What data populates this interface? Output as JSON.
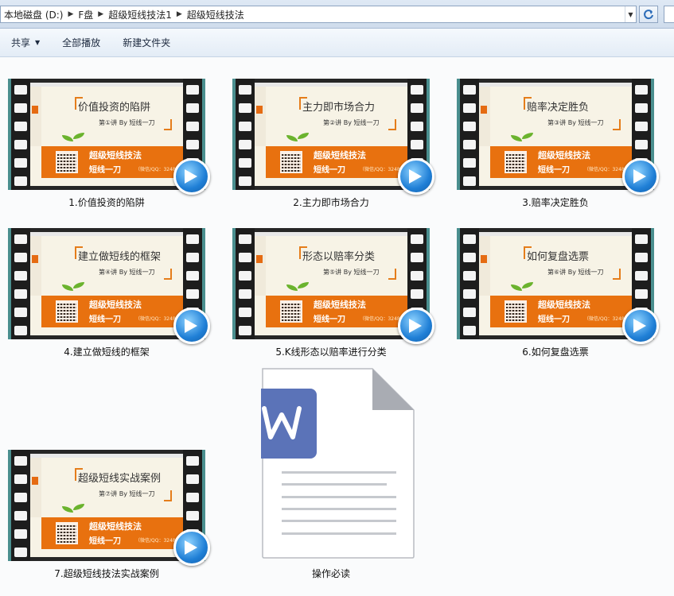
{
  "address": {
    "crumbs": [
      "本地磁盘 (D:)",
      "F盘",
      "超级短线技法1",
      "超级短线技法"
    ]
  },
  "toolbar": {
    "share": "共享",
    "play_all": "全部播放",
    "new_folder": "新建文件夹"
  },
  "slide": {
    "brand": "超级短线技法",
    "author": "短线一刀",
    "contact": "（微信/QQ：324898"
  },
  "videos": [
    {
      "name": "1.价值投资的陷阱",
      "slide_title": "价值投资的陷阱",
      "lecture": "第①讲   By 短线一刀"
    },
    {
      "name": "2.主力即市场合力",
      "slide_title": "主力即市场合力",
      "lecture": "第②讲   By 短线一刀"
    },
    {
      "name": "3.赔率决定胜负",
      "slide_title": "赔率决定胜负",
      "lecture": "第③讲   By 短线一刀"
    },
    {
      "name": "4.建立做短线的框架",
      "slide_title": "建立做短线的框架",
      "lecture": "第④讲   By 短线一刀"
    },
    {
      "name": "5.K线形态以赔率进行分类",
      "slide_title": "形态以赔率分类",
      "lecture": "第⑤讲   By 短线一刀"
    },
    {
      "name": "6.如何复盘选票",
      "slide_title": "如何复盘选票",
      "lecture": "第⑥讲   By 短线一刀"
    },
    {
      "name": "7.超级短线技法实战案例",
      "slide_title": "超级短线实战案例",
      "lecture": "第⑦讲   By 短线一刀"
    }
  ],
  "document": {
    "name": "操作必读",
    "icon": "wps-writer-document-icon",
    "accent": "#5b73b8"
  },
  "colors": {
    "banner": "#e8710f",
    "play": "#1f7fd6"
  }
}
